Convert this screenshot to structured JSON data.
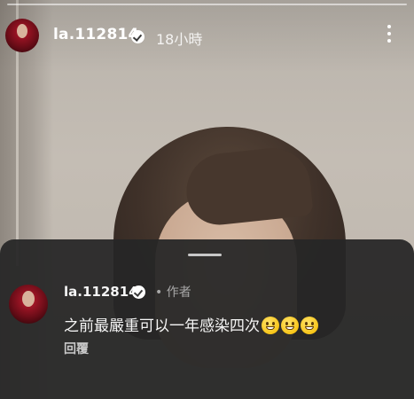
{
  "story_header": {
    "username": "la.112814",
    "verified": true,
    "timestamp": "18小時"
  },
  "comment": {
    "username": "la.112814",
    "verified": true,
    "author_tag": "• 作者",
    "text": "之前最嚴重可以一年感染四次",
    "emojis": [
      "grinning-face-emoji",
      "grinning-face-emoji",
      "grinning-face-emoji"
    ],
    "reply_label": "回覆"
  },
  "colors": {
    "sheet_background": "#262626",
    "text_primary": "#f5f5f5",
    "text_secondary": "#a8a8a8"
  }
}
